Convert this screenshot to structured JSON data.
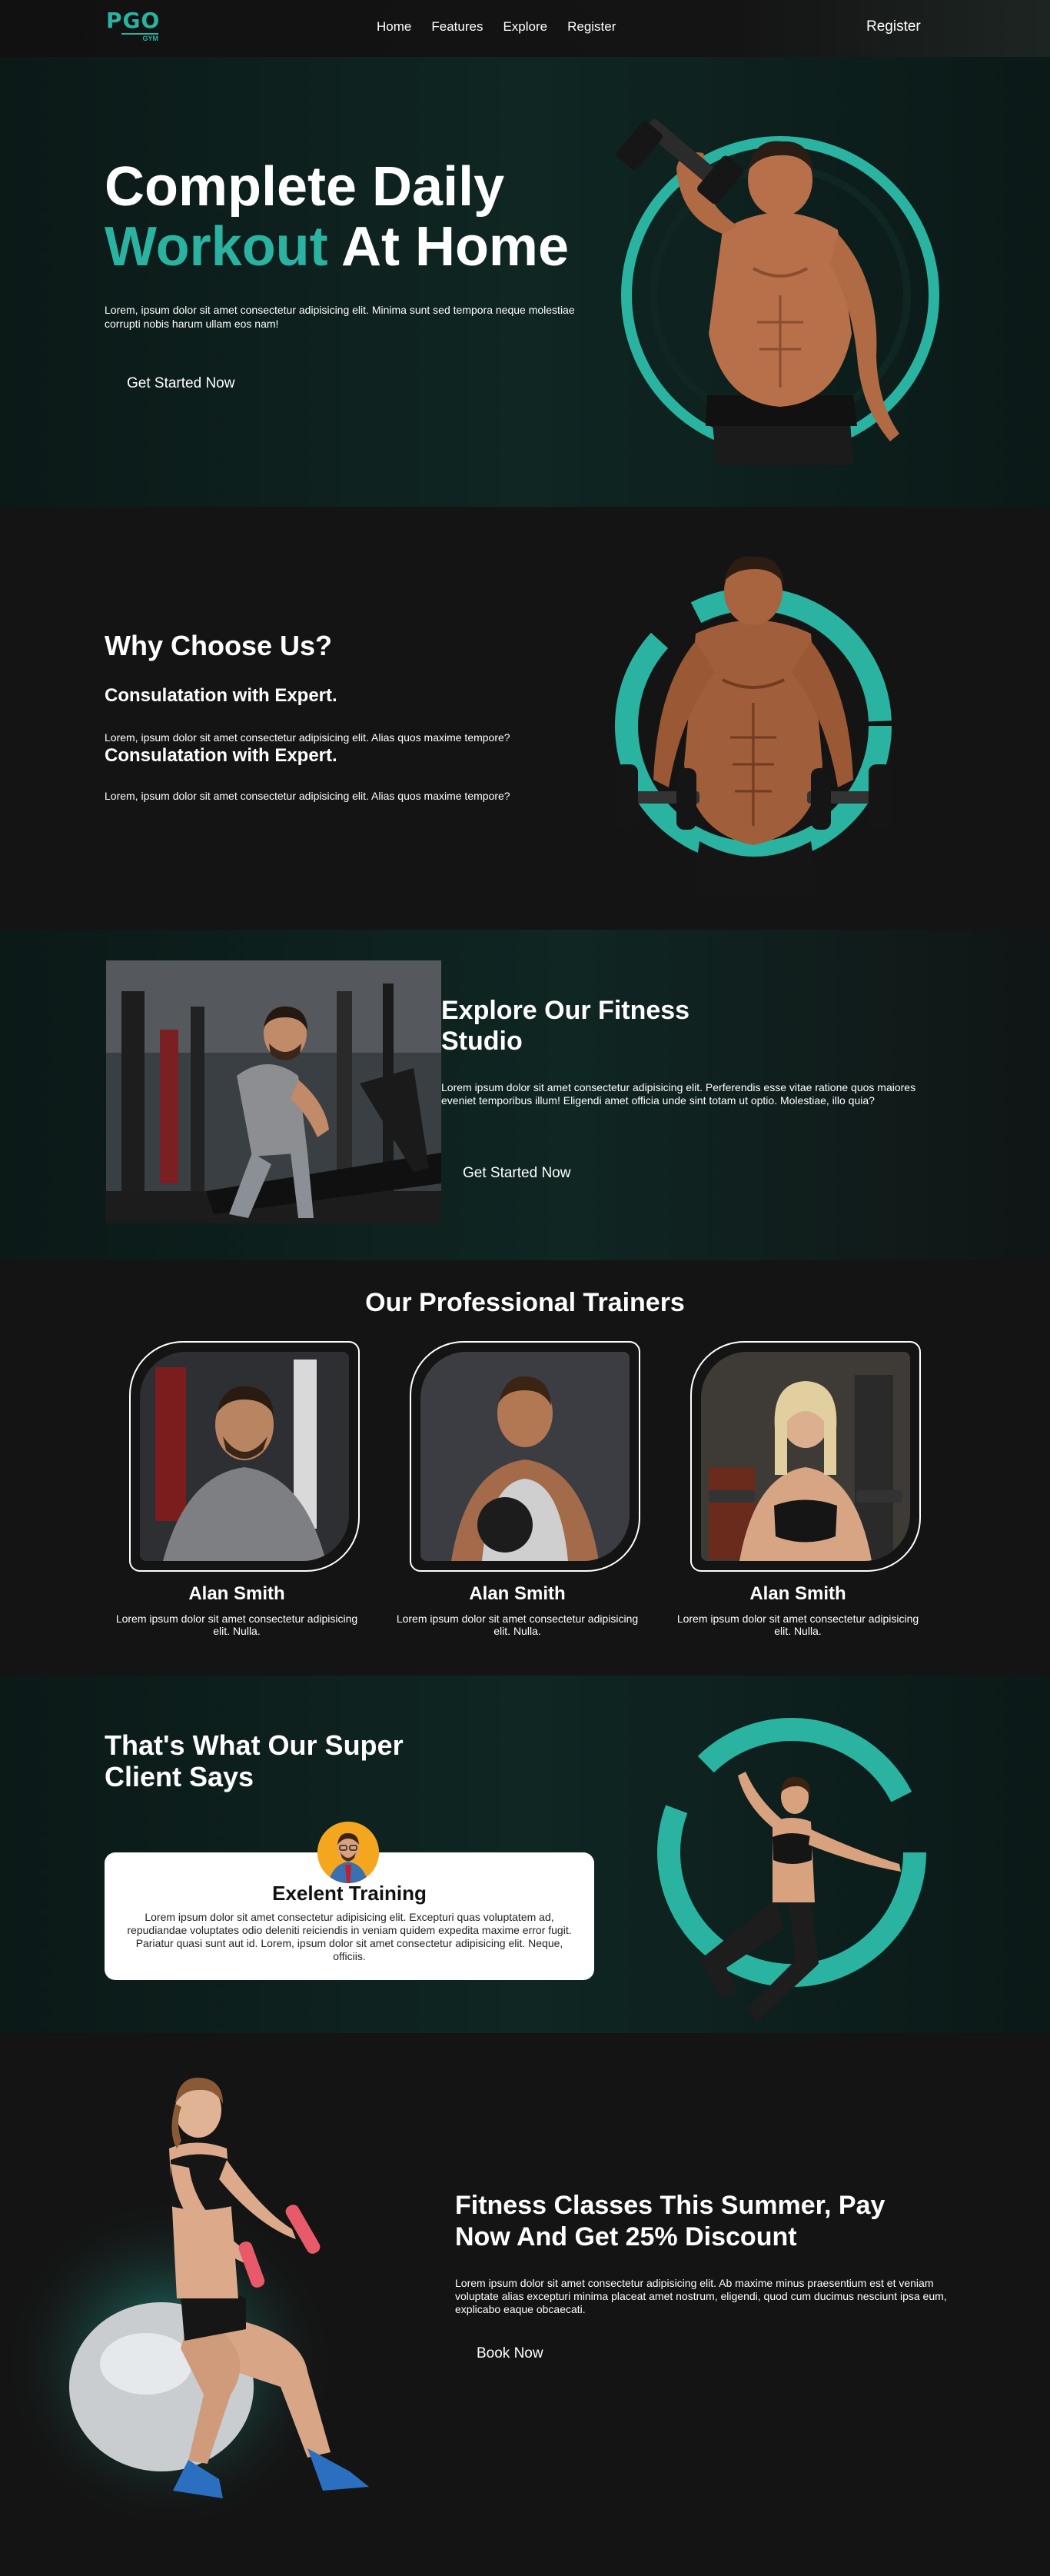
{
  "nav": {
    "logo_main": "PGO",
    "logo_sub": "GYM",
    "links": [
      "Home",
      "Features",
      "Explore",
      "Register"
    ],
    "register": "Register"
  },
  "hero": {
    "title_line1": "Complete Daily",
    "title_highlight": "Workout",
    "title_rest": " At Home",
    "description": "Lorem, ipsum dolor sit amet consectetur adipisicing elit. Minima sunt sed tempora neque molestiae corrupti nobis harum ullam eos nam!",
    "button": "Get Started Now"
  },
  "why": {
    "title": "Why Choose Us?",
    "items": [
      {
        "heading": "Consulatation with Expert.",
        "text": "Lorem, ipsum dolor sit amet consectetur adipisicing elit. Alias quos maxime tempore?"
      },
      {
        "heading": "Consulatation with Expert.",
        "text": "Lorem, ipsum dolor sit amet consectetur adipisicing elit. Alias quos maxime tempore?"
      }
    ]
  },
  "explore": {
    "title": "Explore Our Fitness Studio",
    "description": "Lorem ipsum dolor sit amet consectetur adipisicing elit. Perferendis esse vitae ratione quos maiores eveniet temporibus illum! Eligendi amet officia unde sint totam ut optio. Molestiae, illo quia?",
    "button": "Get Started Now"
  },
  "trainers": {
    "title": "Our Professional Trainers",
    "cards": [
      {
        "name": "Alan Smith",
        "description": "Lorem ipsum dolor sit amet consectetur adipisicing elit. Nulla."
      },
      {
        "name": "Alan Smith",
        "description": "Lorem ipsum dolor sit amet consectetur adipisicing elit. Nulla."
      },
      {
        "name": "Alan Smith",
        "description": "Lorem ipsum dolor sit amet consectetur adipisicing elit. Nulla."
      }
    ]
  },
  "testimonial": {
    "title": "That's What Our Super Client Says",
    "card_title": "Exelent Training",
    "card_text": "Lorem ipsum dolor sit amet consectetur adipisicing elit. Excepturi quas voluptatem ad, repudiandae voluptates odio deleniti reiciendis in veniam quidem expedita maxime error fugit. Pariatur quasi sunt aut id. Lorem, ipsum dolor sit amet consectetur adipisicing elit. Neque, officiis."
  },
  "promo": {
    "title": "Fitness Classes This Summer, Pay Now And Get 25% Discount",
    "description": "Lorem ipsum dolor sit amet consectetur adipisicing elit. Ab maxime minus praesentium est et veniam voluptate alias excepturi minima placeat amet nostrum, eligendi, quod cum ducimus nesciunt ipsa eum, explicabo eaque obcaecati.",
    "button": "Book Now"
  },
  "colors": {
    "accent": "#2bb3a1",
    "background": "#141414",
    "section_alt": "#0f2623"
  }
}
